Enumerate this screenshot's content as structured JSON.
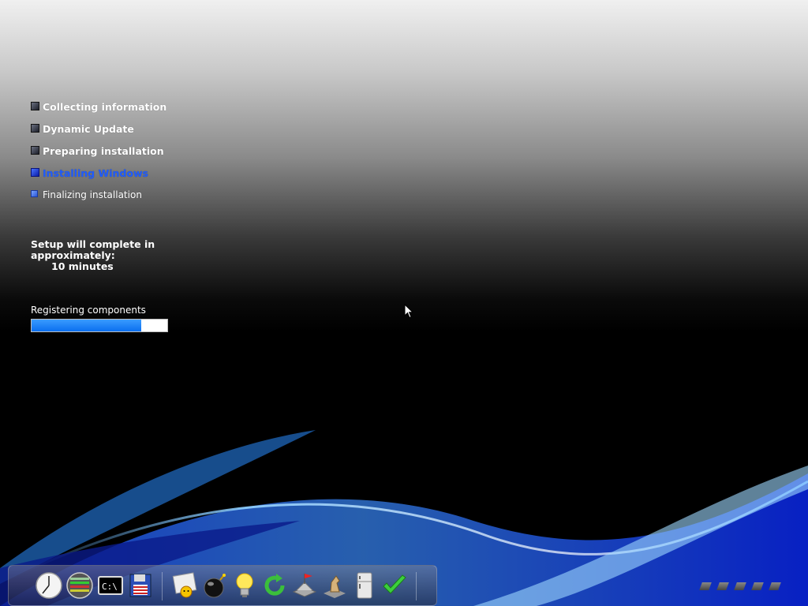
{
  "steps": [
    {
      "label": "Collecting information",
      "state": "done"
    },
    {
      "label": "Dynamic Update",
      "state": "done"
    },
    {
      "label": "Preparing installation",
      "state": "done"
    },
    {
      "label": "Installing Windows",
      "state": "current"
    },
    {
      "label": "Finalizing installation",
      "state": "future"
    }
  ],
  "time_remaining": {
    "line1": "Setup will complete in",
    "line2": "approximately:",
    "value": "10 minutes"
  },
  "task": {
    "label": "Registering components",
    "progress": 0.81
  },
  "dock_icons": [
    {
      "name": "clock-icon"
    },
    {
      "name": "network-monitor-icon"
    },
    {
      "name": "command-prompt-icon",
      "text": "C:\\"
    },
    {
      "name": "floppy-disk-icon"
    },
    {
      "name": "minesweeper-icon"
    },
    {
      "name": "bomb-icon"
    },
    {
      "name": "lightbulb-icon"
    },
    {
      "name": "refresh-icon"
    },
    {
      "name": "castle-flag-icon"
    },
    {
      "name": "chess-knight-icon"
    },
    {
      "name": "refrigerator-icon"
    },
    {
      "name": "checkmark-icon"
    }
  ],
  "colors": {
    "current_step": "#1f5cff",
    "progress_fill": "#0a6ff0"
  }
}
